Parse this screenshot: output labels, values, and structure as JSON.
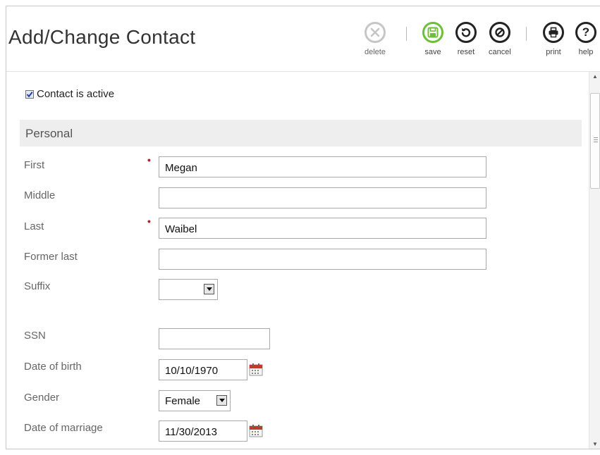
{
  "header": {
    "title": "Add/Change Contact"
  },
  "toolbar": {
    "delete_label": "delete",
    "save_label": "save",
    "reset_label": "reset",
    "cancel_label": "cancel",
    "print_label": "print",
    "help_label": "help",
    "help_glyph": "?"
  },
  "active": {
    "label": "Contact is active",
    "checked": true
  },
  "personal": {
    "heading": "Personal",
    "first_label": "First",
    "first_value": "Megan",
    "middle_label": "Middle",
    "middle_value": "",
    "last_label": "Last",
    "last_value": "Waibel",
    "former_last_label": "Former last",
    "former_last_value": "",
    "suffix_label": "Suffix",
    "suffix_value": "",
    "ssn_label": "SSN",
    "ssn_value": "",
    "dob_label": "Date of birth",
    "dob_value": "10/10/1970",
    "gender_label": "Gender",
    "gender_value": "Female",
    "marriage_label": "Date of marriage",
    "marriage_value": "11/30/2013",
    "required_mark": "•"
  },
  "colors": {
    "save_accent": "#6cbf3a",
    "required": "#b22222",
    "section_bg": "#eeeeee",
    "calendar": "#c0392b"
  },
  "icons": [
    "delete-icon",
    "save-icon",
    "reset-icon",
    "cancel-icon",
    "print-icon",
    "help-icon",
    "calendar-icon",
    "checkbox-checked-icon",
    "dropdown-arrow-icon"
  ]
}
